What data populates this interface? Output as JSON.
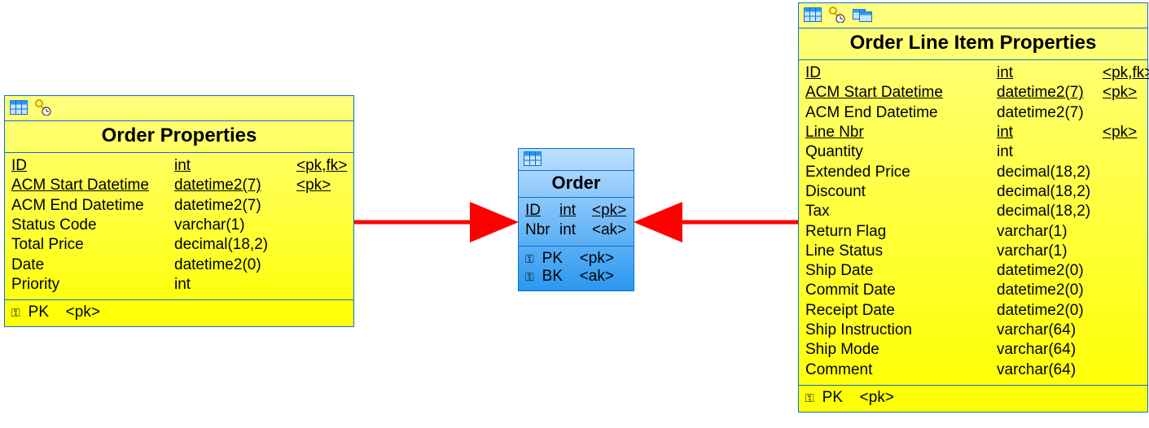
{
  "entities": {
    "order_properties": {
      "title": "Order Properties",
      "columns": [
        {
          "name": "ID",
          "type": "int",
          "keys": "<pk,fk>",
          "underline": true
        },
        {
          "name": "ACM Start Datetime",
          "type": "datetime2(7)",
          "keys": "<pk>",
          "underline": true
        },
        {
          "name": "ACM End Datetime",
          "type": "datetime2(7)",
          "keys": ""
        },
        {
          "name": "Status Code",
          "type": "varchar(1)",
          "keys": ""
        },
        {
          "name": "Total Price",
          "type": "decimal(18,2)",
          "keys": ""
        },
        {
          "name": "Date",
          "type": "datetime2(0)",
          "keys": ""
        },
        {
          "name": "Priority",
          "type": "int",
          "keys": ""
        }
      ],
      "footer_keys": [
        {
          "name": "PK",
          "spec": "<pk>"
        }
      ]
    },
    "order": {
      "title": "Order",
      "columns": [
        {
          "name": "ID",
          "type": "int",
          "keys": "<pk>",
          "underline": true
        },
        {
          "name": "Nbr",
          "type": "int",
          "keys": "<ak>"
        }
      ],
      "footer_keys": [
        {
          "name": "PK",
          "spec": "<pk>"
        },
        {
          "name": "BK",
          "spec": "<ak>"
        }
      ]
    },
    "order_line_item_properties": {
      "title": "Order Line Item Properties",
      "columns": [
        {
          "name": "ID",
          "type": "int",
          "keys": "<pk,fk>",
          "underline": true
        },
        {
          "name": "ACM Start Datetime",
          "type": "datetime2(7)",
          "keys": "<pk>",
          "underline": true
        },
        {
          "name": "ACM End Datetime",
          "type": "datetime2(7)",
          "keys": ""
        },
        {
          "name": "Line Nbr",
          "type": "int",
          "keys": "<pk>",
          "underline": true
        },
        {
          "name": "Quantity",
          "type": "int",
          "keys": ""
        },
        {
          "name": "Extended Price",
          "type": "decimal(18,2)",
          "keys": ""
        },
        {
          "name": "Discount",
          "type": "decimal(18,2)",
          "keys": ""
        },
        {
          "name": "Tax",
          "type": "decimal(18,2)",
          "keys": ""
        },
        {
          "name": "Return Flag",
          "type": "varchar(1)",
          "keys": ""
        },
        {
          "name": "Line Status",
          "type": "varchar(1)",
          "keys": ""
        },
        {
          "name": "Ship Date",
          "type": "datetime2(0)",
          "keys": ""
        },
        {
          "name": "Commit Date",
          "type": "datetime2(0)",
          "keys": ""
        },
        {
          "name": "Receipt Date",
          "type": "datetime2(0)",
          "keys": ""
        },
        {
          "name": "Ship Instruction",
          "type": "varchar(64)",
          "keys": ""
        },
        {
          "name": "Ship Mode",
          "type": "varchar(64)",
          "keys": ""
        },
        {
          "name": "Comment",
          "type": "varchar(64)",
          "keys": ""
        }
      ],
      "footer_keys": [
        {
          "name": "PK",
          "spec": "<pk>"
        }
      ]
    }
  },
  "relationships": [
    {
      "from": "order_properties",
      "to": "order"
    },
    {
      "from": "order_line_item_properties",
      "to": "order"
    }
  ],
  "colors": {
    "yellow_light": "#ffff80",
    "yellow": "#ffff00",
    "blue_light": "#bfe0ff",
    "blue": "#2a98f0",
    "border": "#0b6fd6",
    "arrow": "#ff0000"
  },
  "chart_data": {
    "type": "table",
    "description": "ER diagram: two property tables each reference the Order table via ID.",
    "nodes": [
      "Order Properties",
      "Order",
      "Order Line Item Properties"
    ],
    "edges": [
      {
        "from": "Order Properties",
        "to": "Order",
        "on": "ID"
      },
      {
        "from": "Order Line Item Properties",
        "to": "Order",
        "on": "ID"
      }
    ]
  }
}
